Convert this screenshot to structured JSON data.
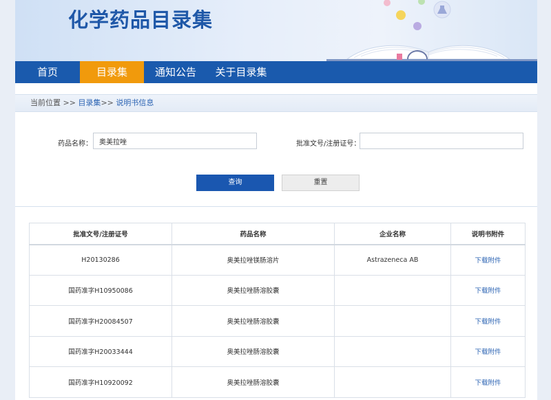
{
  "site": {
    "title": "化学药品目录集"
  },
  "nav": {
    "items": [
      {
        "label": "首页",
        "active": false
      },
      {
        "label": "目录集",
        "active": true
      },
      {
        "label": "通知公告",
        "active": false
      },
      {
        "label": "关于目录集",
        "active": false
      }
    ]
  },
  "breadcrumb": {
    "prefix": "当前位置 >> ",
    "level1": "目录集",
    "sep": ">> ",
    "level2": "说明书信息"
  },
  "search": {
    "drug_name_label": "药品名称：",
    "drug_name_value": "奥美拉唑",
    "approval_label": "批准文号/注册证号：",
    "approval_value": "",
    "query_button": "查询",
    "reset_button": "重置"
  },
  "table": {
    "headers": [
      "批准文号/注册证号",
      "药品名称",
      "企业名称",
      "说明书附件"
    ],
    "rows": [
      {
        "approval": "H20130286",
        "drug": "奥美拉唑镁肠溶片",
        "company": "Astrazeneca AB",
        "attachment": "下载附件"
      },
      {
        "approval": "国药准字H10950086",
        "drug": "奥美拉唑肠溶胶囊",
        "company": "",
        "attachment": "下载附件"
      },
      {
        "approval": "国药准字H20084507",
        "drug": "奥美拉唑肠溶胶囊",
        "company": "",
        "attachment": "下载附件"
      },
      {
        "approval": "国药准字H20033444",
        "drug": "奥美拉唑肠溶胶囊",
        "company": "",
        "attachment": "下载附件"
      },
      {
        "approval": "国药准字H10920092",
        "drug": "奥美拉唑肠溶胶囊",
        "company": "",
        "attachment": "下载附件"
      }
    ]
  },
  "colors": {
    "brand_blue": "#1a5aad",
    "nav_active": "#f19a0c",
    "link": "#2c64b3"
  }
}
